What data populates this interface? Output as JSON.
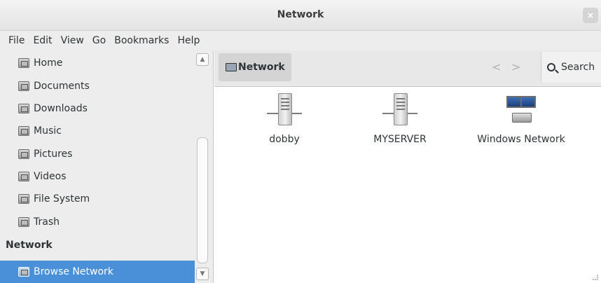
{
  "window": {
    "title": "Network",
    "close_glyph": "×"
  },
  "menubar": [
    "File",
    "Edit",
    "View",
    "Go",
    "Bookmarks",
    "Help"
  ],
  "sidebar": {
    "places": [
      {
        "label": "Home",
        "icon": "home-folder-icon"
      },
      {
        "label": "Documents",
        "icon": "documents-folder-icon"
      },
      {
        "label": "Downloads",
        "icon": "downloads-folder-icon"
      },
      {
        "label": "Music",
        "icon": "music-folder-icon"
      },
      {
        "label": "Pictures",
        "icon": "pictures-folder-icon"
      },
      {
        "label": "Videos",
        "icon": "videos-folder-icon"
      },
      {
        "label": "File System",
        "icon": "harddisk-icon"
      },
      {
        "label": "Trash",
        "icon": "trash-icon"
      }
    ],
    "network_heading": "Network",
    "network_items": [
      {
        "label": "Browse Network",
        "icon": "network-icon",
        "selected": true
      }
    ],
    "scroll_up_glyph": "▲",
    "scroll_down_glyph": "▼"
  },
  "toolbar": {
    "location": "Network",
    "back_glyph": "<",
    "forward_glyph": ">",
    "search_label": "Search"
  },
  "content": {
    "items": [
      {
        "label": "dobby",
        "icon": "server-icon"
      },
      {
        "label": "MYSERVER",
        "icon": "server-icon"
      },
      {
        "label": "Windows Network",
        "icon": "windows-network-icon"
      }
    ]
  },
  "colors": {
    "selection": "#4a90d9",
    "sidebar_bg": "#ededed",
    "content_bg": "#ffffff",
    "text": "#2e3436"
  }
}
